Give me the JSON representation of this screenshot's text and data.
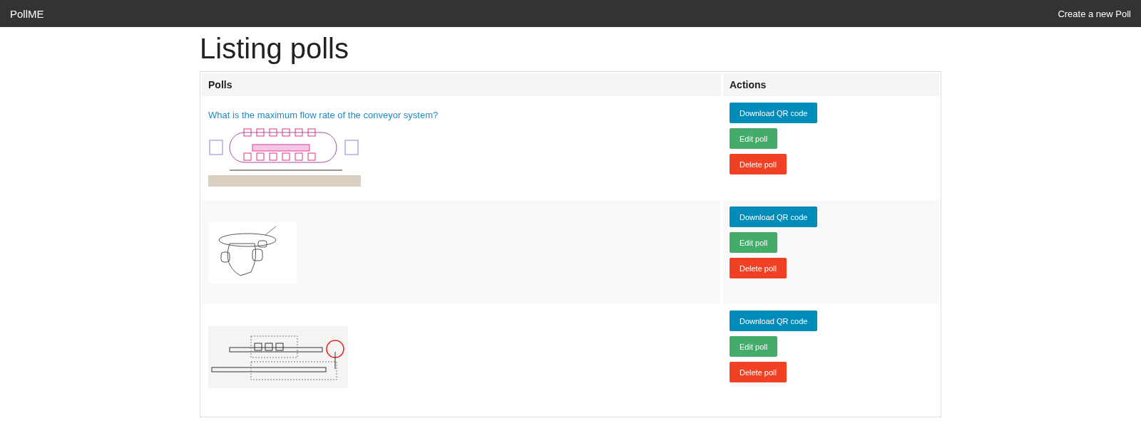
{
  "navbar": {
    "brand": "PollME",
    "link": "Create a new Poll"
  },
  "title": "Listing polls",
  "table": {
    "columns": [
      "Polls",
      "Actions"
    ],
    "rows": [
      {
        "question": "What is the maximum flow rate of the conveyor system?",
        "image": {
          "kind": "conveyor"
        },
        "actions": [
          {
            "label": "Download QR code",
            "kind": "info"
          },
          {
            "label": "Edit poll",
            "kind": "success"
          },
          {
            "label": "Delete poll",
            "kind": "danger"
          }
        ]
      },
      {
        "image": {
          "kind": "cam"
        },
        "actions": [
          {
            "label": "Download QR code",
            "kind": "info"
          },
          {
            "label": "Edit poll",
            "kind": "success"
          },
          {
            "label": "Delete poll",
            "kind": "danger"
          }
        ]
      },
      {
        "image": {
          "kind": "line"
        },
        "actions": [
          {
            "label": "Download QR code",
            "kind": "info"
          },
          {
            "label": "Edit poll",
            "kind": "success"
          },
          {
            "label": "Delete poll",
            "kind": "danger"
          }
        ]
      }
    ]
  }
}
